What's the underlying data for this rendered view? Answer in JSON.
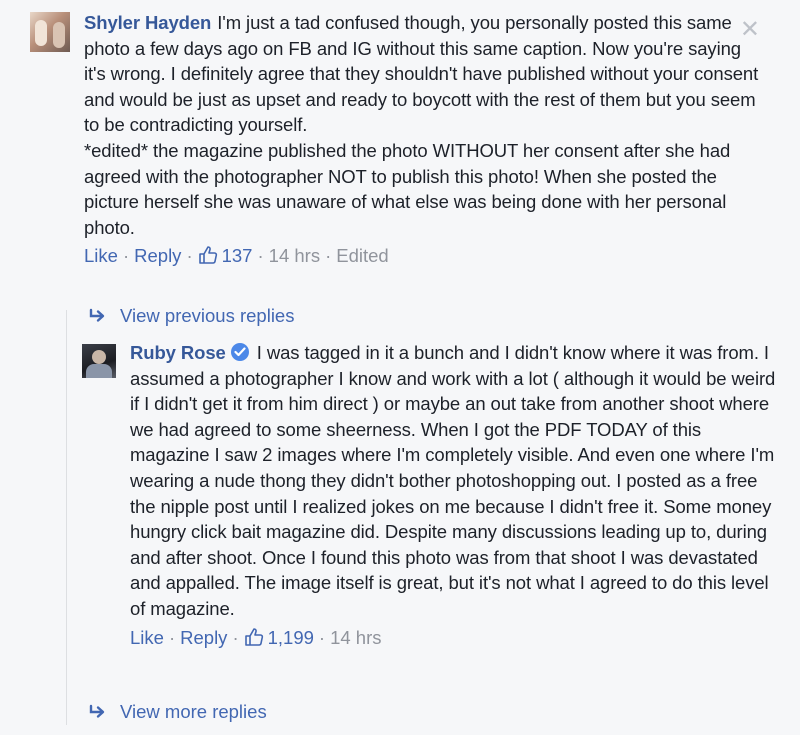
{
  "comment": {
    "author": "Shyler Hayden",
    "text_p1": "I'm just a tad confused though, you personally posted this same photo a few days ago on FB and IG without this same caption. Now you're saying it's wrong. I definitely agree that they shouldn't have published without your consent and would be just as upset and ready to boycott with the rest of them but you seem to be contradicting yourself.",
    "text_p2": "*edited* the magazine published the photo WITHOUT her consent after she had agreed with the photographer NOT to publish this photo! When she posted the picture herself she was unaware of what else was being done with her personal photo.",
    "like_label": "Like",
    "reply_label": "Reply",
    "like_count": "137",
    "time": "14 hrs",
    "edited": "Edited",
    "close_icon": "close-icon"
  },
  "view_previous": "View previous replies",
  "reply": {
    "author": "Ruby Rose",
    "verified_icon": "verified-badge-icon",
    "text": "I was tagged in it a bunch and I didn't know where it was from. I assumed a photographer I know and work with a lot ( although it would be weird if I didn't get it from him direct ) or maybe an out take from another shoot where we had agreed to some sheerness. When I got the PDF TODAY of this magazine I saw 2 images where I'm completely visible. And even one where I'm wearing a nude thong they didn't bother photoshopping out. I posted as a free the nipple post until I realized jokes on me because I didn't free it. Some money hungry click bait magazine did. Despite many discussions leading up to, during and after shoot. Once I found this photo was from that shoot I was devastated and appalled. The image itself is great, but it's not what I agreed to do this level of magazine.",
    "like_label": "Like",
    "reply_label": "Reply",
    "like_count": "1,199",
    "time": "14 hrs"
  },
  "view_more": "View more replies",
  "colors": {
    "link": "#4267b2",
    "author": "#365899",
    "meta": "#90949c",
    "background": "#f6f7f9"
  }
}
